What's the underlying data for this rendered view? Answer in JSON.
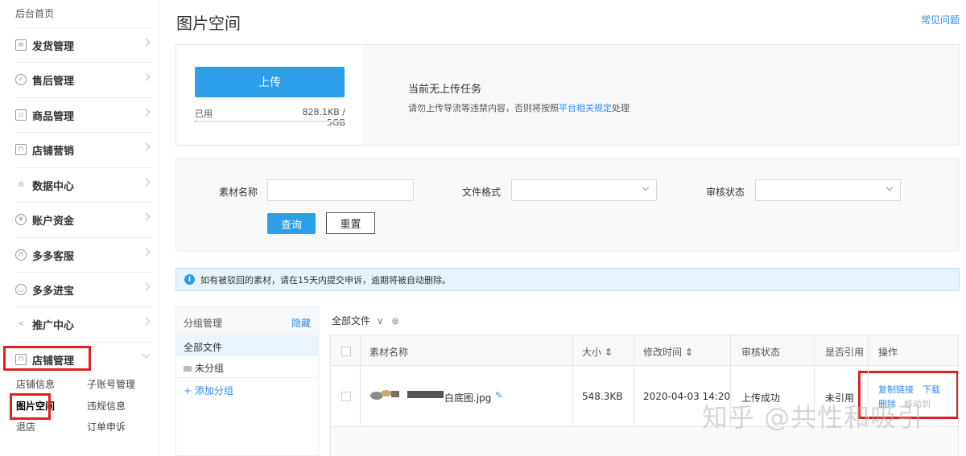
{
  "sidebar": {
    "home": "后台首页",
    "items": [
      {
        "label": "发货管理",
        "icon": "document-icon"
      },
      {
        "label": "售后管理",
        "icon": "check-circle-icon"
      },
      {
        "label": "商品管理",
        "icon": "image-icon"
      },
      {
        "label": "店铺营销",
        "icon": "gift-icon"
      },
      {
        "label": "数据中心",
        "icon": "bar-chart-icon"
      },
      {
        "label": "账户资金",
        "icon": "yen-circle-icon"
      },
      {
        "label": "多多客服",
        "icon": "headset-icon"
      },
      {
        "label": "多多进宝",
        "icon": "treasure-icon"
      },
      {
        "label": "推广中心",
        "icon": "share-icon"
      },
      {
        "label": "店铺管理",
        "icon": "store-icon"
      }
    ],
    "sub": {
      "shop_info": "店铺信息",
      "sub_account": "子账号管理",
      "image_space": "图片空间",
      "violation": "违规信息",
      "close_shop": "退店",
      "order_appeal": "订单申诉"
    }
  },
  "header": {
    "title": "图片空间",
    "faq": "常见问题"
  },
  "upload": {
    "button": "上传",
    "used_label": "已用",
    "used_value": "828.1KB / 5GB",
    "used_fraction": 0.0002,
    "status": "当前无上传任务",
    "notice_prefix": "请勿上传导流等违禁内容，否则将按照",
    "notice_link": "平台相关规定",
    "notice_suffix": "处理"
  },
  "filter": {
    "name_label": "素材名称",
    "name_value": "",
    "format_label": "文件格式",
    "format_value": "",
    "review_label": "审核状态",
    "review_value": "",
    "query": "查询",
    "reset": "重置"
  },
  "info": {
    "icon": "info-icon",
    "text": "如有被驳回的素材，请在15天内提交申诉，逾期将被自动删除。"
  },
  "groups": {
    "title": "分组管理",
    "hide": "隐藏",
    "all": "全部文件",
    "ungrouped": "未分组",
    "add": "+ 添加分组"
  },
  "files": {
    "header": "全部文件",
    "columns": {
      "name": "素材名称",
      "size": "大小 ⇕",
      "modified": "修改时间 ⇕",
      "review": "审核状态",
      "referenced": "是否引用",
      "actions": "操作"
    },
    "rows": [
      {
        "name": "白底图.jpg",
        "size": "548.3KB",
        "modified": "2020-04-03 14:20",
        "review": "上传成功",
        "referenced": "未引用",
        "copy_link": "复制链接",
        "download": "下载",
        "delete": "删除",
        "move": "移动到"
      }
    ]
  },
  "watermark": "知乎 @共性和吸引",
  "colors": {
    "primary": "#2d9ee8",
    "link": "#2d8cf0",
    "highlight_box": "#e0201e"
  }
}
